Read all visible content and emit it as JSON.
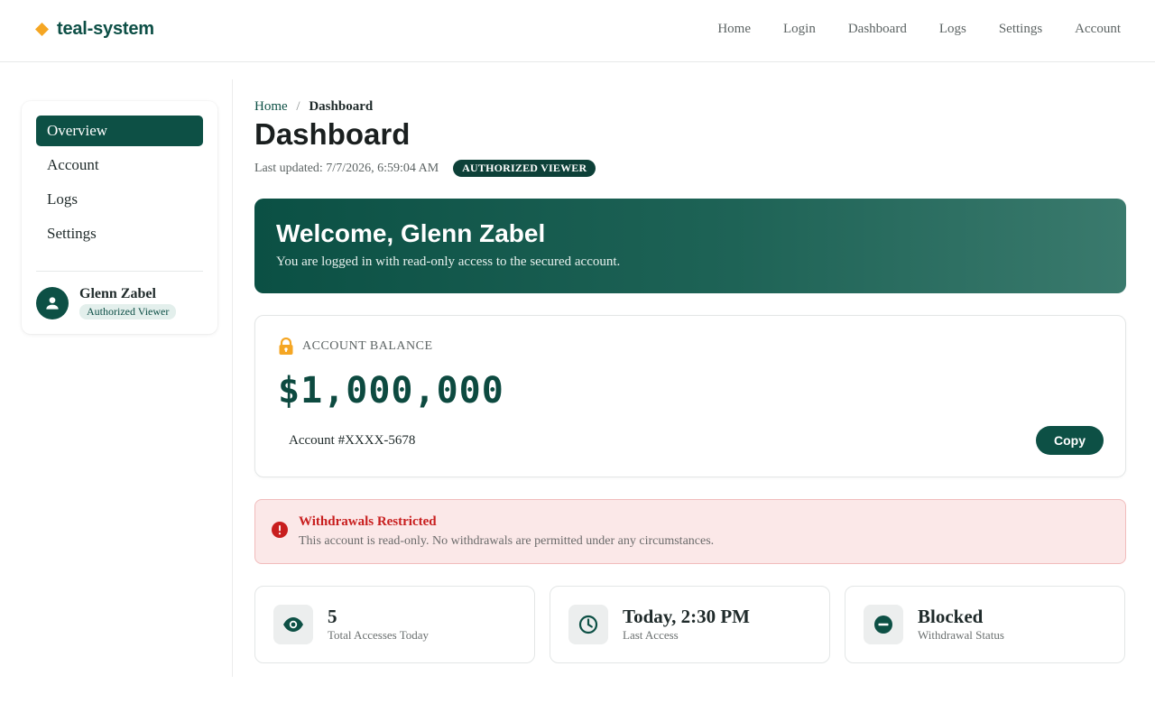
{
  "app": {
    "brand": "teal-system",
    "colors": {
      "primary": "#0d5045",
      "accent": "#f5a623",
      "danger": "#c81e1e"
    }
  },
  "nav": {
    "items": [
      "Home",
      "Login",
      "Dashboard",
      "Logs",
      "Settings",
      "Account"
    ]
  },
  "sidebar": {
    "items": [
      {
        "label": "Overview",
        "active": true
      },
      {
        "label": "Account",
        "active": false
      },
      {
        "label": "Logs",
        "active": false
      },
      {
        "label": "Settings",
        "active": false
      }
    ],
    "user": {
      "name": "Glenn Zabel",
      "role": "Authorized Viewer",
      "icon": "person-icon"
    }
  },
  "breadcrumb": {
    "home": "Home",
    "separator": "/",
    "current": "Dashboard"
  },
  "page": {
    "title": "Dashboard",
    "last_updated": "Last updated: 7/7/2026, 6:59:04 AM",
    "role_badge": "AUTHORIZED VIEWER"
  },
  "welcome": {
    "title": "Welcome, Glenn Zabel",
    "subtitle": "You are logged in with read-only access to the secured account."
  },
  "balance": {
    "icon": "lock-icon",
    "label": "ACCOUNT BALANCE",
    "amount": "$1,000,000",
    "account": "Account #XXXX-5678",
    "copy_label": "Copy"
  },
  "alert": {
    "icon": "alert-circle-icon",
    "title": "Withdrawals Restricted",
    "text": "This account is read-only. No withdrawals are permitted under any circumstances."
  },
  "stats": [
    {
      "icon": "eye-icon",
      "value": "5",
      "label": "Total Accesses Today"
    },
    {
      "icon": "clock-icon",
      "value": "Today, 2:30 PM",
      "label": "Last Access"
    },
    {
      "icon": "blocked-icon",
      "value": "Blocked",
      "label": "Withdrawal Status"
    }
  ]
}
